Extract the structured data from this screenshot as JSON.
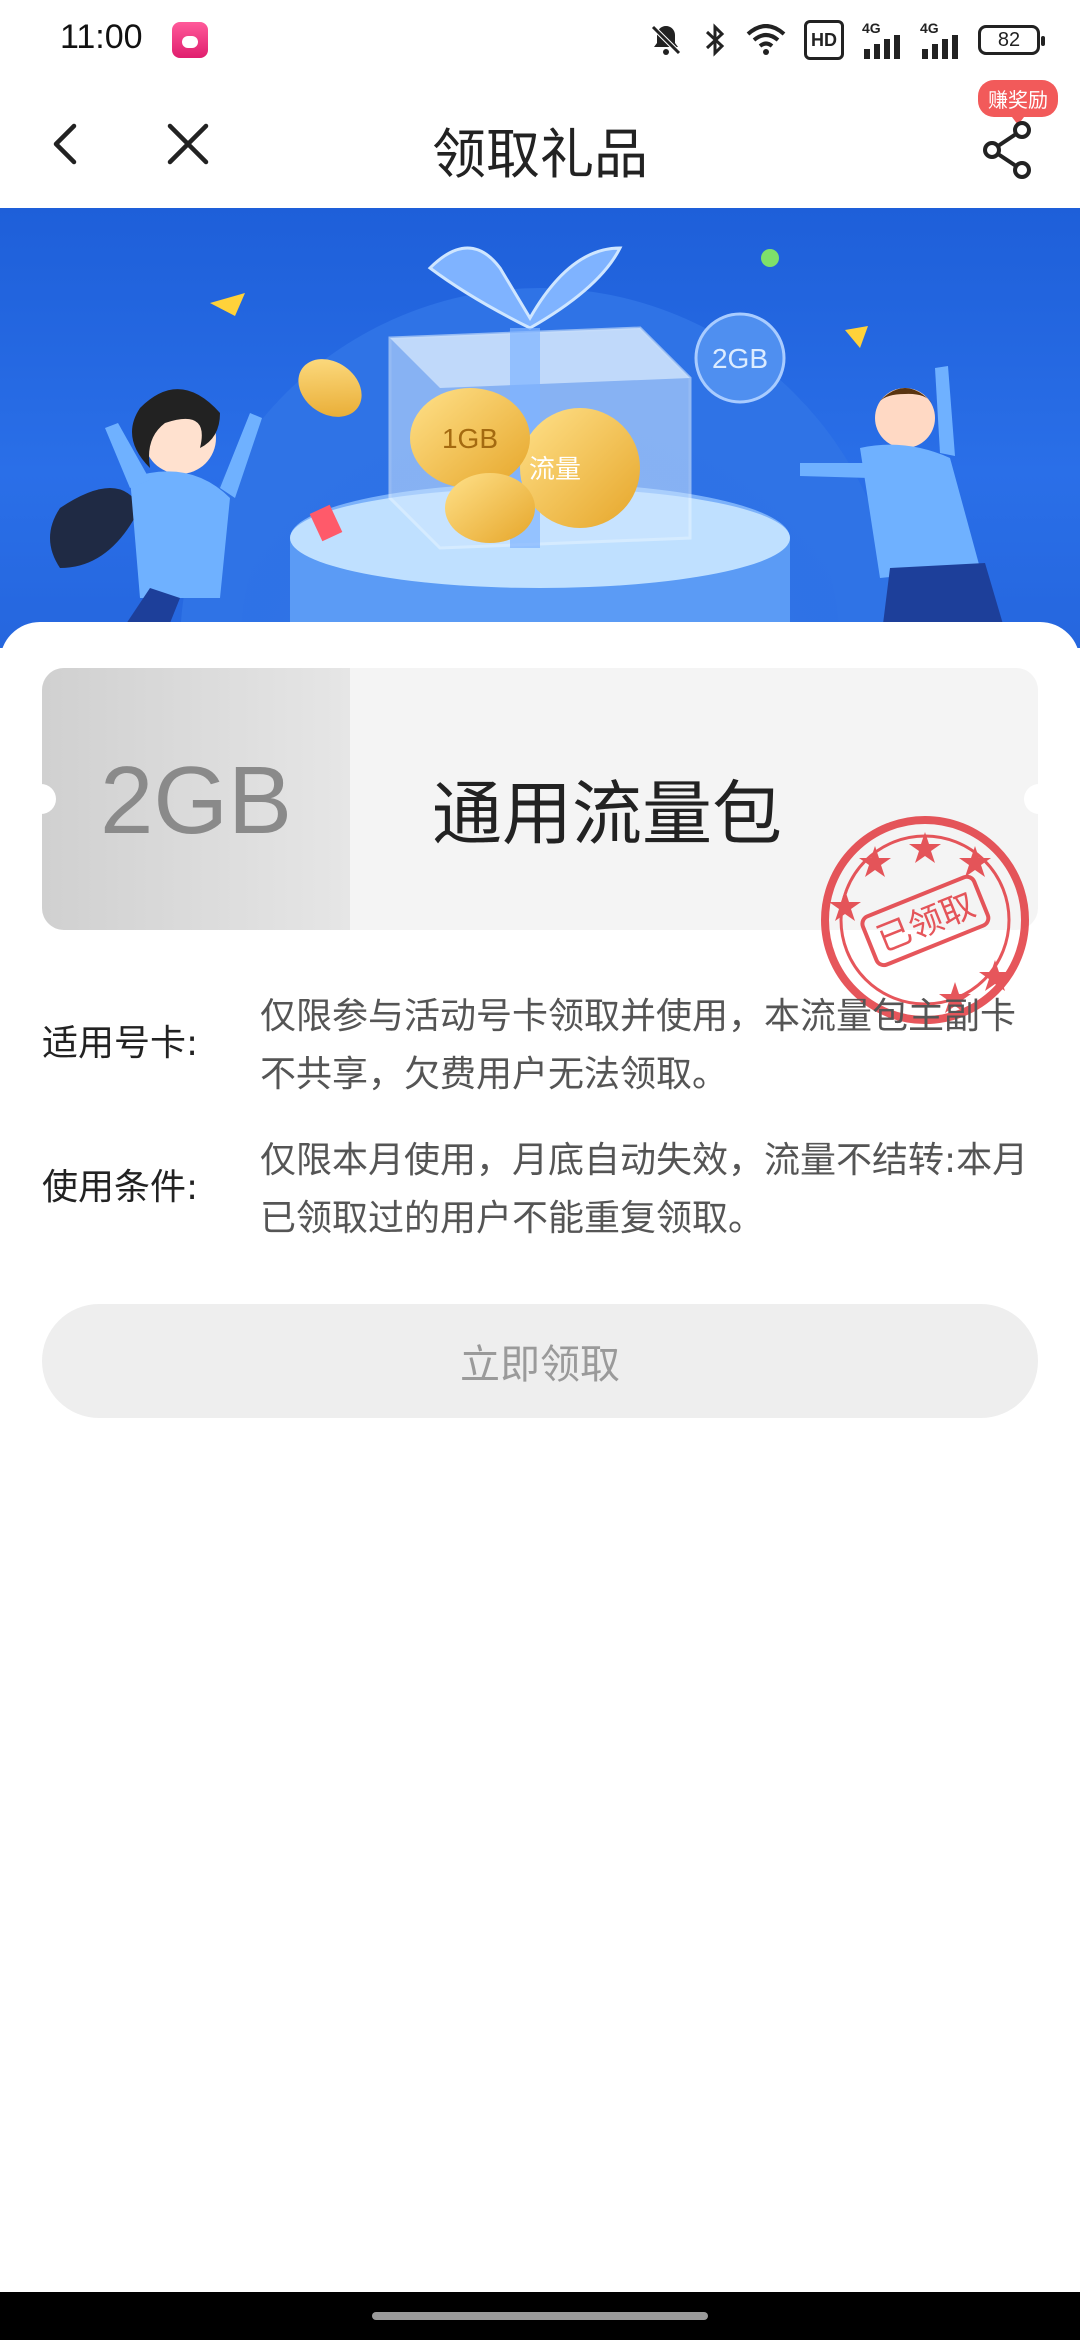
{
  "status": {
    "time": "11:00",
    "hd_label": "HD",
    "signal1_label": "4G",
    "signal2_label": "4G",
    "battery": "82"
  },
  "nav": {
    "title": "领取礼品",
    "reward_badge": "赚奖励"
  },
  "banner": {
    "coin_big": "1GB",
    "coin_flow": "流量",
    "bubble": "2GB"
  },
  "coupon": {
    "amount": "2GB",
    "name": "通用流量包",
    "stamp_text": "已领取"
  },
  "info": [
    {
      "label": "适用号卡:",
      "text": "仅限参与活动号卡领取并使用，本流量包主副卡不共享，欠费用户无法领取。"
    },
    {
      "label": "使用条件:",
      "text": "仅限本月使用，月底自动失效，流量不结转:本月已领取过的用户不能重复领取。"
    }
  ],
  "button": {
    "label": "立即领取"
  },
  "colors": {
    "banner_blue": "#2a6fe8",
    "stamp_red": "#e2393f",
    "badge_red": "#f25a5a"
  }
}
